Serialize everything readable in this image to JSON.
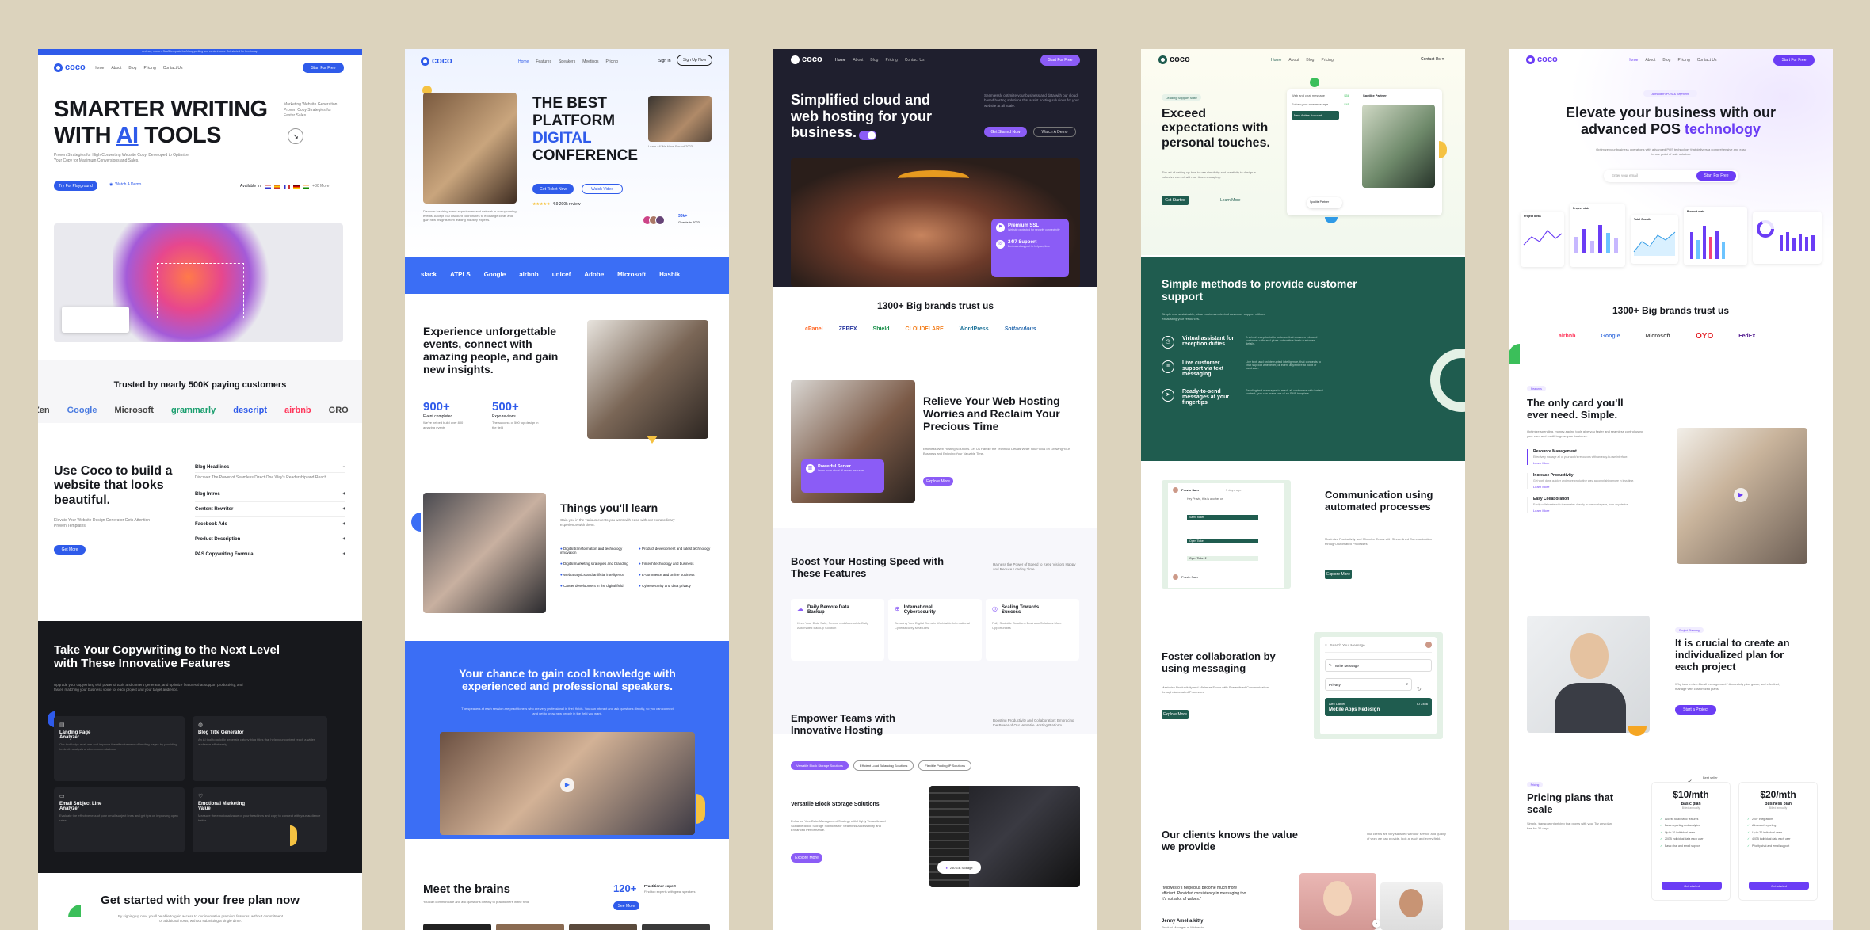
{
  "c1": {
    "topbar": "A clean, modern SaaS template for AI copywriting and content tools. Get started for free today!",
    "logo": "coco",
    "nav": [
      "Home",
      "About",
      "Blog",
      "Pricing",
      "Contact Us"
    ],
    "cta": "Start For Free",
    "hero_l1": "SMARTER WRITING",
    "hero_l2a": "WITH ",
    "hero_l2b": "AI",
    "hero_l2c": " TOOLS",
    "hero_side": "Marketing Website Generation Proven Copy Strategies for Faster Sales",
    "hero_sub": "Proven Strategies for High-Converting Website Copy. Developed to Optimize Your Copy for Maximum Conversions and Sales.",
    "try_btn": "Try For Playground",
    "watch": "Watch A Demo",
    "available": "Available In:",
    "more": "+30 More",
    "trusted": "Trusted by nearly 500K paying customers",
    "brands": [
      "Zen",
      "Google",
      "Microsoft",
      "grammarly",
      "descript",
      "airbnb",
      "GRO"
    ],
    "build": "Use Coco to build a website that looks beautiful.",
    "build_sub": "Elevate Your Website Design Generator Gets Attention Proven Templates",
    "build_btn": "Get More",
    "faq": [
      "Blog Headlines",
      "Blog Intros",
      "Content Rewriter",
      "Facebook Ads",
      "Product Description",
      "PAS Copywriting Formula"
    ],
    "faq_body": "Discover The Power of Seamless Direct One Way's Readership and Reach",
    "dark_title": "Take Your Copywriting to the Next Level with These Innovative Features",
    "dark_sub": "Upgrade your copywriting with powerful tools and content generator, and optimize features that support productivity, and faster, matching your business voice for each project and your target audience.",
    "features": [
      {
        "name": "Landing Page Analyzer",
        "desc": "Our tool helps evaluate and improve the effectiveness of landing pages by providing in-depth analysis and recommendations."
      },
      {
        "name": "Blog Title Generator",
        "desc": "An AI tool to quickly generate catchy blog titles that help your content reach a wider audience effortlessly."
      },
      {
        "name": "Email Subject Line Analyzer",
        "desc": "Evaluate the effectiveness of your email subject lines and get tips on improving open rates."
      },
      {
        "name": "Emotional Marketing Value",
        "desc": "Measure the emotional value of your headlines and copy to connect with your audience better."
      }
    ],
    "free_title": "Get started with your free plan now",
    "free_sub": "By signing up now, you'll be able to gain access to our innovative premium features, without commitment or additional costs, without submitting a single dime."
  },
  "c2": {
    "logo": "coco",
    "nav": [
      "Home",
      "Features",
      "Speakers",
      "Meetings",
      "Pricing"
    ],
    "signin": "Sign In",
    "signup": "Sign Up Now",
    "hero_l1": "THE BEST",
    "hero_l2": "PLATFORM",
    "hero_l3": "DIGITAL",
    "hero_l4": "CONFERENCE",
    "get_ticket": "Get Ticket Now",
    "watch": "Watch Video",
    "rating": "4.9 200k review",
    "left_caption": "Discover inspiring event experiences and network in our upcoming events. Accept 250 discount coordinates to exchange ideas and gain new insights from leading industry experts.",
    "right_caption": "Learn All We Have Round 2023",
    "guests_n": "30k+",
    "guests": "Guests in 2023",
    "logos": [
      "slack",
      "ATPLS",
      "Google",
      "airbnb",
      "unicef",
      "Adobe",
      "Microsoft",
      "Hashik"
    ],
    "exp_title": "Experience unforgettable events, connect with amazing people, and gain new insights.",
    "stat1_n": "900+",
    "stat1_l": "Event completed",
    "stat1_d": "We've helped build over 800 amazing events",
    "stat2_n": "500+",
    "stat2_l": "Expo reviews",
    "stat2_d": "The success of 500 top design in the field",
    "learn_title": "Things you'll learn",
    "learn_sub": "Gain you in the various events you want with ease with our extraordinary experience with them.",
    "learn_items": [
      "Digital transformation and technology innovation",
      "Product development and latest technology",
      "Digital marketing strategies and branding",
      "Fintech technology and business",
      "Web analytics and artificial intelligence",
      "E-commerce and online business",
      "Career development in the digital field",
      "Cybersecurity and data privacy"
    ],
    "blue_title": "Your chance to gain cool knowledge with experienced and professional speakers.",
    "blue_sub": "The speakers at each session are practitioners who are very professional in their fields. You can interact and ask questions directly, so you can connect and get to know new people in the field you want.",
    "brains_title": "Meet the brains",
    "brains_sub": "You can communicate and ask questions directly to practitioners in the field.",
    "brains_n": "120+",
    "brains_l": "Practitioner expert",
    "brains_d": "Find top experts with great speakers",
    "see_more": "See More"
  },
  "c3": {
    "logo": "coco",
    "nav": [
      "Home",
      "About",
      "Blog",
      "Pricing",
      "Contact Us"
    ],
    "cta": "Start For Free",
    "hero_title": "Simplified cloud and web hosting for your business.",
    "hero_sub": "Seamlessly optimize your business and data with our cloud-based hosting solutions that assist hosting solutions for your website at all scale.",
    "get_started": "Get Started Now",
    "watch": "Watch A Demo",
    "ssl_t": "Premium SSL",
    "ssl_d": "Website protected for security connectivity",
    "support_t": "24/7 Support",
    "support_d": "Dedicated support to help anytime",
    "brands_title": "1300+ Big brands trust us",
    "brands": [
      "cPanel",
      "ZEPEX",
      "Shield",
      "CLOUDFLARE",
      "WordPress",
      "Softaculous"
    ],
    "relieve_title": "Relieve Your Web Hosting Worries and Reclaim Your Precious Time",
    "relieve_sub": "Effortless Web Hosting Solutions. Let Us Handle the Technical Details While You Focus on Growing Your Business and Enjoying Your Valuable Time.",
    "explore": "Explore More",
    "powerful_t": "Powerful Server",
    "powerful_d": "Learn more about all server resources",
    "boost_title": "Boost Your Hosting Speed with These Features",
    "boost_sub": "Harness the Power of Speed to Keep Visitors Happy and Reduce Loading Time",
    "features": [
      {
        "name": "Daily Remote Data Backup",
        "desc": "Keep Your Data Safe, Secure and Accessible Daily Automated Backup Solution"
      },
      {
        "name": "International Cybersecurity",
        "desc": "Securing Your Digital Domain Worldwide International Cybersecurity Measures"
      },
      {
        "name": "Scaling Towards Success",
        "desc": "Fully Scalable Solutions Business Solutions More Opportunities"
      }
    ],
    "empower_title": "Empower Teams with Innovative Hosting",
    "empower_sub": "Boosting Productivity and Collaboration: Embracing the Power of Our Versatile Hosting Platform",
    "tabs": [
      "Versatile Block Storage Solutions",
      "Efficient Load Balancing Solutions",
      "Flexible Pooling IP Solutions"
    ],
    "vbs_title": "Versatile Block Storage Solutions",
    "vbs_sub": "Enhance Your Data Management Strategy with Highly Versatile and Scalable Block Storage Solutions for Seamless Accessibility and Enhanced Performance.",
    "explore2": "Explore More",
    "storage_badge": "250 GB Storage"
  },
  "c4": {
    "logo": "coco",
    "nav": [
      "Home",
      "About",
      "Blog",
      "Pricing"
    ],
    "contact": "Contact Us",
    "badge": "Leading Support Suite",
    "hero_title": "Exceed expectations with personal touches.",
    "hero_sub": "The art of setting up how to use simplicity and creativity to design a cohesive current with our time messaging.",
    "get_started": "Get Started",
    "learn": "Learn More",
    "mock_rows": [
      "Web and chat message",
      "Follow your new message"
    ],
    "mock_status": "New Active Account",
    "mock_name": "Spotlite Partner",
    "green_title": "Simple methods to provide customer support",
    "green_sub": "Simple and sustainable, clear business-oriented customer support without exhausting your resources.",
    "items": [
      {
        "name": "Virtual assistant for reception duties",
        "desc": "A virtual receptionist is software that answers inbound customer calls and gives out routine basic customer details."
      },
      {
        "name": "Live customer support via text messaging",
        "desc": "Live text, and uninterrupted intelligence, that connects to chat support whenever, or even, anywhere at point of purchase."
      },
      {
        "name": "Ready-to-send messages at your fingertips",
        "desc": "Sending text messages to reach all customers with instant content, you can make use of an SMS template."
      }
    ],
    "comm_title": "Communication using automated processes",
    "comm_sub": "Maximize Productivity and Minimize Errors with Streamlined Communication through Automated Processes",
    "explore": "Explore More",
    "chat_name": "Pravin Sam",
    "chat_time": "3 days ago",
    "chat_rows": [
      "Hey Pravin, this is another on",
      "Same ticket",
      "Open Ticket",
      "Open Ticket 2"
    ],
    "foster_title": "Foster collaboration by using messaging",
    "foster_sub": "Maximize Productivity and Minimize Errors with Streamlined Communication through Automated Processes",
    "explore2": "Explore More",
    "search_msg": "Search Your Message",
    "write_msg": "Write Message",
    "priority": "Privacy",
    "ticket_name": "Alex Daniel",
    "ticket_id": "ID 2456",
    "ticket_app": "Mobile Apps Redesign",
    "clients_title": "Our clients knows the value we provide",
    "clients_sub": "Our clients are very satisfied with our service and quality of work we can provide, look at each and every field.",
    "quote": "\"Midwesto's helped us become much more efficient. Provided consistency in messaging too. It's not a lot of values.\"",
    "quote_name": "Jenny Amelia kitty",
    "quote_role": "Product Manager at Midwesto"
  },
  "c5": {
    "logo": "coco",
    "nav": [
      "Home",
      "About",
      "Blog",
      "Pricing",
      "Contact Us"
    ],
    "cta": "Start For Free",
    "badge": "A modern POS & payment",
    "hero_a": "Elevate your business with our advanced POS ",
    "hero_b": "technology",
    "hero_sub": "Optimize your business operations with advanced POS technology that delivers a comprehensive and easy to use point of sale solution.",
    "email": "Enter your email",
    "start": "Start For Free",
    "brands_title": "1300+ Big brands trust us",
    "brands": [
      "airbnb",
      "Google",
      "Microsoft",
      "OYO",
      "FedEx"
    ],
    "card_badge": "Features",
    "card_title": "The only card you'll ever need. Simple.",
    "card_sub": "Optimize spending, money-saving tools give you faster and seamless control using your card and credit to grow your business.",
    "features": [
      {
        "name": "Resource Management",
        "desc": "Effectively manage all of your work's resources with an easy-to-use interface."
      },
      {
        "name": "Increase Productivity",
        "desc": "Get work done quicker and more productive way, accomplishing more in less time."
      },
      {
        "name": "Easy Collaboration",
        "desc": "Easily collaborate with teammates directly in one workspace, from any device."
      }
    ],
    "learn": "Learn More",
    "plan_badge": "Project Planning",
    "plan_title": "It is crucial to create an individualized plan for each project",
    "plan_sub": "Why is one-size-fits-all management? Accurately plan goals, and effectively manage with customized plans.",
    "get_project": "Start a Project",
    "pricing_badge": "Pricing",
    "pricing_title": "Pricing plans that scale",
    "pricing_sub": "Simple, transparent pricing that grows with you. Try any plan free for 30 days.",
    "best_seller": "Best seller",
    "plans": [
      {
        "price": "$10/mth",
        "name": "Basic plan",
        "billed": "Billed annually",
        "features": [
          "Access to all basic features",
          "Basic reporting and analytics",
          "Up to 10 individual users",
          "20GB individual data each user",
          "Basic chat and email support"
        ],
        "btn": "Get started"
      },
      {
        "price": "$20/mth",
        "name": "Business plan",
        "billed": "Billed annually",
        "features": [
          "200+ integrations",
          "Advanced reporting",
          "Up to 20 individual users",
          "40GB individual data each user",
          "Priority chat and email support"
        ],
        "btn": "Get started"
      }
    ],
    "dash_labels": [
      "Project Ideas",
      "Project stats",
      "Total Growth",
      "Product stats"
    ]
  }
}
